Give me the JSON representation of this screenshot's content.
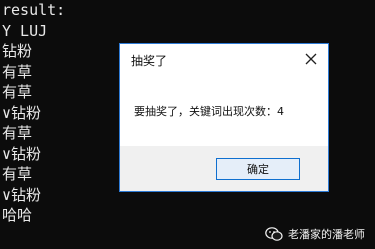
{
  "console": {
    "lines": [
      "result:",
      "Y LUJ",
      "钻粉",
      "有草",
      "有草",
      "∨钻粉",
      "有草",
      "∨钻粉",
      "有草",
      "∨钻粉",
      "哈哈"
    ]
  },
  "dialog": {
    "title": "抽奖了",
    "message": "要抽奖了，关键词出现次数：4",
    "ok_label": "确定",
    "accent_color": "#0f6fcf"
  },
  "watermark": {
    "text": "老潘家的潘老师",
    "icon": "chat-bubbles-icon"
  }
}
